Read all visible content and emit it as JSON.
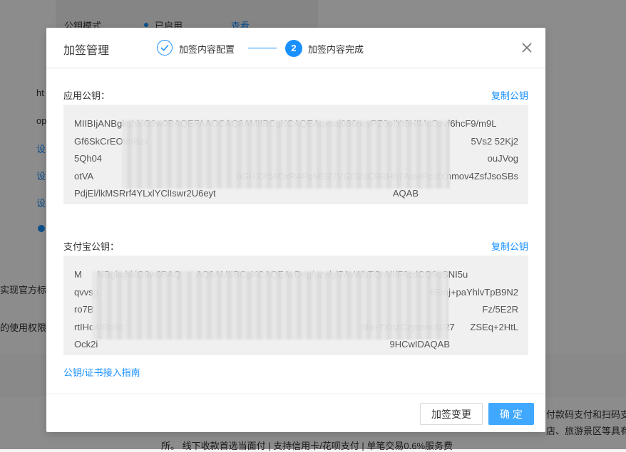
{
  "background": {
    "pubkey_mode_label": "公钥模式",
    "pubkey_mode_status": "已启用",
    "pubkey_mode_link": "查看",
    "partial_left_texts": [
      "ht",
      "op",
      "设",
      "设",
      "设"
    ],
    "realize_text": "实现官方标",
    "rights_text": "的使用权限，",
    "right_snippet_1": "付款码支付和扫码支",
    "right_snippet_2": "店、旅游景区等具有",
    "bottom_strip": "所。  线下收款首选当面付 | 支持信用卡/花呗支付 | 单笔交易0.6%服务费"
  },
  "modal": {
    "title": "加签管理",
    "steps": [
      {
        "label": "加签内容配置",
        "status": "done"
      },
      {
        "number": "2",
        "label": "加签内容完成",
        "status": "active"
      }
    ],
    "app_pubkey": {
      "label": "应用公钥：",
      "copy_label": "复制公钥",
      "lines": [
        "MIIBIjANBgkqhkiG9w0BAQEFAAOCAQ8AMIIBCgKCAQEAqxsaj986ncyPZ0oIYt0HIMcOzvf6hcF9/m9L",
        "Gf6SkCrEOtmBzk",
        "5Qh04",
        "otVA",
        "PdjEl/lkMSRrf4YLxlYClIswr2U6eyt"
      ],
      "line_tails": [
        "",
        "5Vs2  52Kj2",
        "ouJVog",
        "bGHXX58DxR4PqME27VGO2aC9RHh7AawPctdXnmov4ZsfJsoSBs",
        "AQAB"
      ]
    },
    "alipay_pubkey": {
      "label": "支付宝公钥：",
      "copy_label": "复制公钥",
      "lines": [
        "M      NBgkqhkiG9w0BAQ      AQ8AMIIBCgKCAQEAvDeg/uzy/gl7AvWbTQnVI/F6cdCQ9oSNI5u",
        "qvvsg",
        "ro7B",
        "rtIHcAIBp8c",
        "Ock2i"
      ],
      "line_tails": [
        "",
        "6Emj+paYhlvTpB9N2",
        "Fz/5E2R",
        "nla+7XnzCzycsocN/27      ZSEq+2HtL",
        "9HCwIDAQAB"
      ]
    },
    "guide_link": "公钥/证书接入指南",
    "footer": {
      "change_button": "加签变更",
      "confirm_button": "确 定"
    }
  },
  "colors": {
    "primary": "#1890ff",
    "confirm": "#40a9ff",
    "overlay": "rgba(0,0,0,0.45)"
  },
  "icons": [
    "check-icon",
    "close-icon"
  ]
}
